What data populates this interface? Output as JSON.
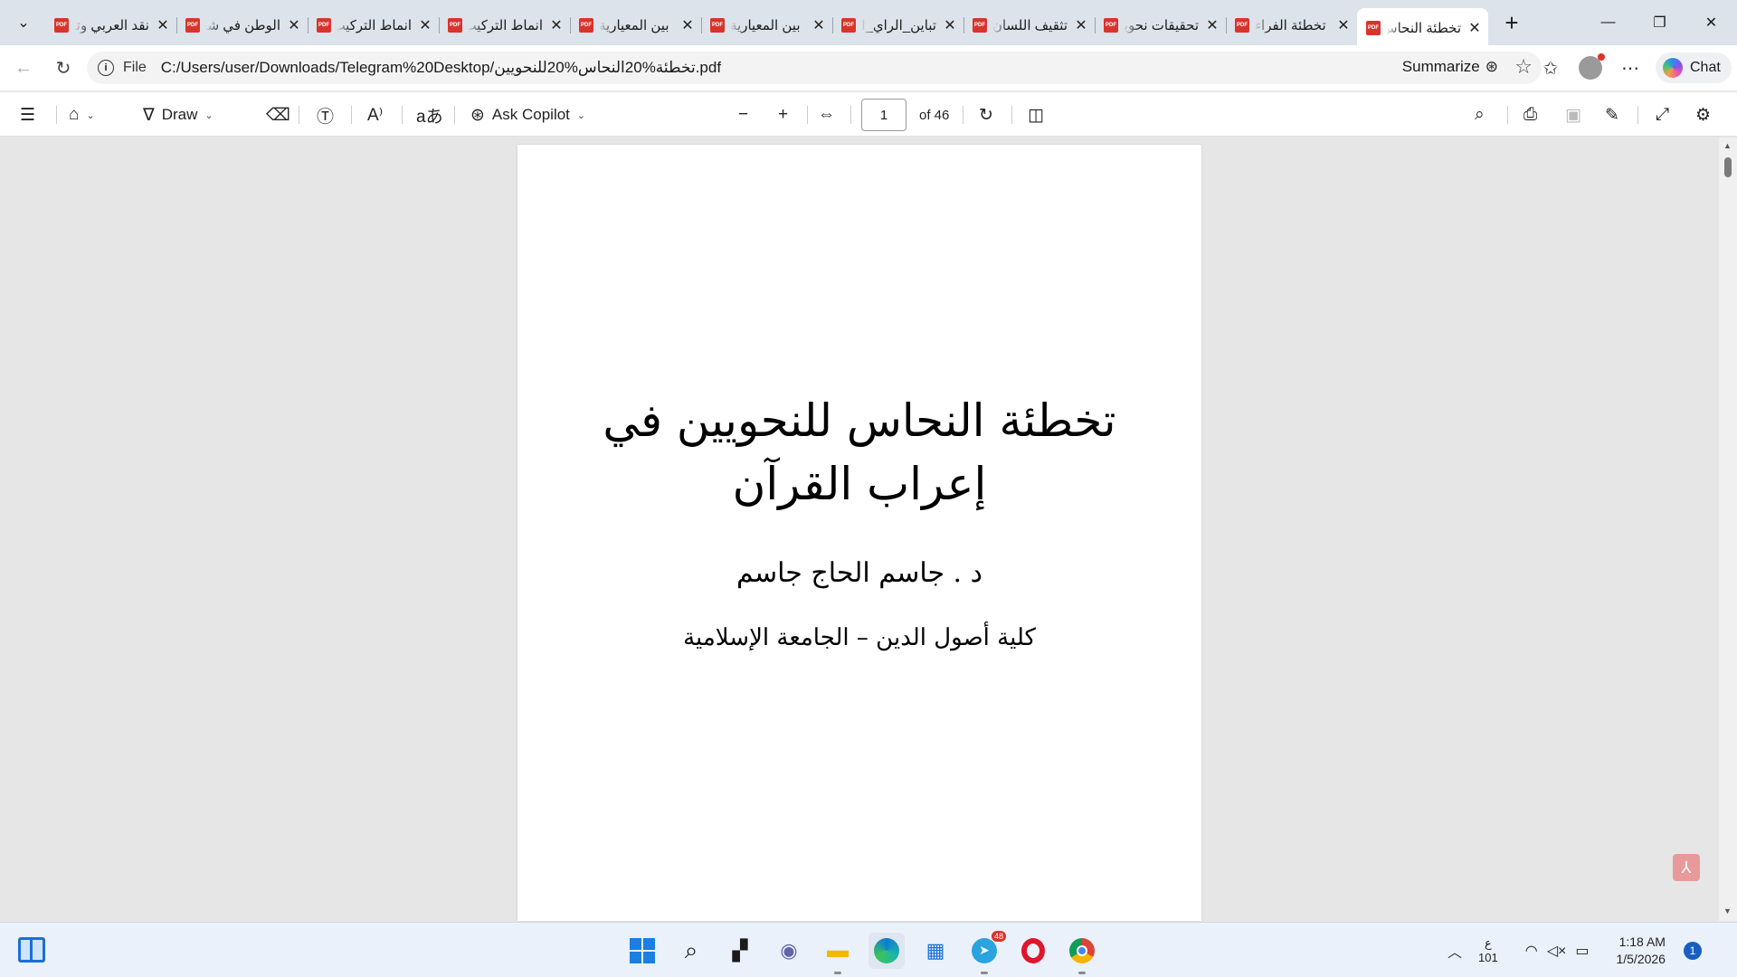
{
  "browser": {
    "tabs": [
      {
        "title": "نقد العربي وتوجيه"
      },
      {
        "title": "الوطن في شعر"
      },
      {
        "title": "انماط التركيب"
      },
      {
        "title": "انماط التركيب"
      },
      {
        "title": "بين المعيارية"
      },
      {
        "title": "بين المعيارية"
      },
      {
        "title": "تباين_الراي_النحوي"
      },
      {
        "title": "تثقيف اللسان"
      },
      {
        "title": "تحقيقات نحوية"
      },
      {
        "title": "تخطئة الفراء"
      },
      {
        "title": "تخطئة النحاس"
      }
    ],
    "pdf_icon_text": "PDF",
    "address": {
      "scheme_label": "File",
      "url": "C:/Users/user/Downloads/Telegram%20Desktop/تخطئة%20النحاس%20للنحويين.pdf",
      "summarize_label": "Summarize"
    },
    "chat_label": "Chat"
  },
  "pdf_toolbar": {
    "draw_label": "Draw",
    "ask_copilot_label": "Ask Copilot",
    "current_page": "1",
    "total_pages_label": "of 46"
  },
  "document": {
    "title": "تخطئة النحاس للنحويين في إعراب القرآن",
    "author": "د . جاسم الحاج جاسم",
    "institution": "كلية أصول الدين – الجامعة الإسلامية"
  },
  "taskbar": {
    "telegram_badge": "48",
    "lang_top": "ع",
    "lang_bottom": "101",
    "time": "1:18 AM",
    "date": "1/5/2026",
    "notification_count": "1"
  }
}
